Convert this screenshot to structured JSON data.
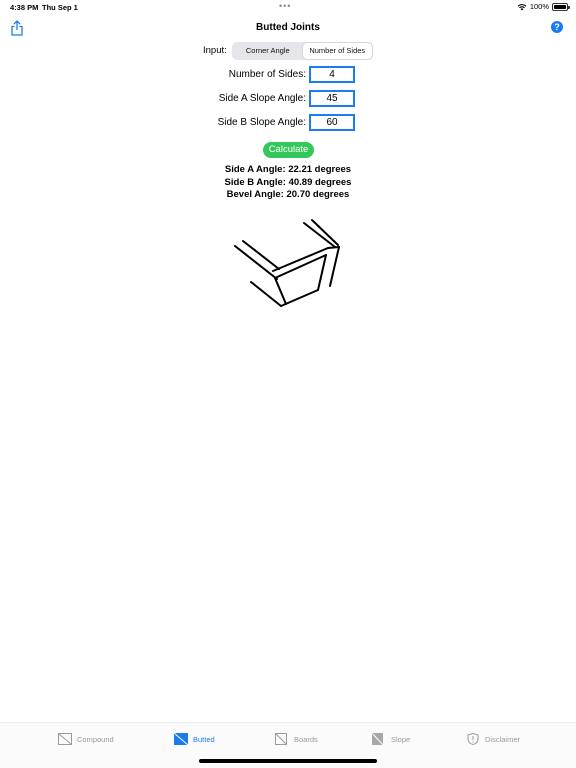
{
  "status": {
    "time": "4:38 PM",
    "date": "Thu Sep 1",
    "battery": "100%"
  },
  "nav": {
    "title": "Butted Joints",
    "help_label": "?"
  },
  "input_selector": {
    "label": "Input:",
    "options": [
      "Corner Angle",
      "Number of Sides"
    ],
    "selected": "Number of Sides"
  },
  "fields": [
    {
      "label": "Number of Sides:",
      "value": "4"
    },
    {
      "label": "Side A Slope Angle:",
      "value": "45"
    },
    {
      "label": "Side B Slope Angle:",
      "value": "60"
    }
  ],
  "calculate_label": "Calculate",
  "results": [
    "Side A Angle: 22.21 degrees",
    "Side B Angle: 40.89 degrees",
    "Bevel Angle: 20.70 degrees"
  ],
  "tabs": [
    {
      "label": "Compound",
      "icon": "compound-icon",
      "active": false
    },
    {
      "label": "Butted",
      "icon": "butted-icon",
      "active": true
    },
    {
      "label": "Boards",
      "icon": "boards-icon",
      "active": false
    },
    {
      "label": "Slope",
      "icon": "slope-icon",
      "active": false
    },
    {
      "label": "Disclaimer",
      "icon": "shield-icon",
      "active": false
    }
  ],
  "colors": {
    "accent": "#1a7cf0",
    "calculate": "#34c759",
    "inactive_tab": "#9a9a9a"
  }
}
